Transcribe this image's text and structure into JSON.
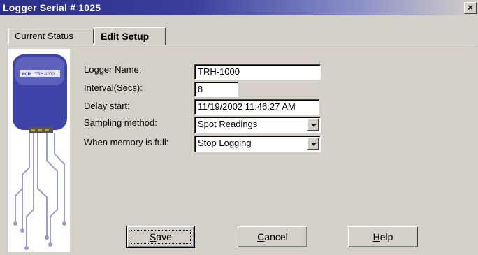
{
  "window": {
    "title": "Logger Serial # 1025",
    "close_glyph": "×"
  },
  "tabs": [
    {
      "label": "Current Status"
    },
    {
      "label": "Edit Setup"
    }
  ],
  "form": {
    "logger_name": {
      "label": "Logger Name:",
      "value": "TRH-1000"
    },
    "interval": {
      "label": "Interval(Secs):",
      "value": "8"
    },
    "delay_start": {
      "label": "Delay start:",
      "value": "11/19/2002 11:46:27 AM"
    },
    "sampling_method": {
      "label": "Sampling method:",
      "value": "Spot Readings"
    },
    "memory_full": {
      "label": "When memory is full:",
      "value": "Stop Logging"
    }
  },
  "device": {
    "label": "TRH-1000",
    "brand": "ACR"
  },
  "buttons": {
    "save": {
      "mnemonic": "S",
      "rest": "ave"
    },
    "cancel": {
      "mnemonic": "C",
      "rest": "ancel"
    },
    "help": {
      "mnemonic": "H",
      "rest": "elp"
    }
  },
  "colors": {
    "title_bar": "#2b2f88",
    "window_bg": "#d4d0c8",
    "device_body": "#3f44a8"
  }
}
